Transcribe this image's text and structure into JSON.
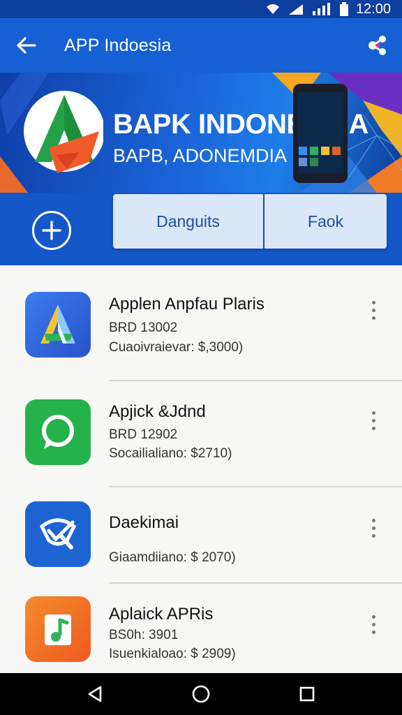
{
  "status_bar": {
    "time": "12:00",
    "icons": [
      "wifi-icon",
      "signal-icon",
      "signal-bars-icon",
      "battery-icon"
    ]
  },
  "app_bar": {
    "title": "APP Indoesia",
    "back_icon": "arrow-left-icon",
    "share_icon": "share-icon"
  },
  "banner": {
    "headline": "BAPK INDONEESIA",
    "subline": "BAPB, ADONEMDIA"
  },
  "actions": {
    "add_icon": "plus-circle-icon",
    "tabs": [
      {
        "label": "Danguits"
      },
      {
        "label": "Faok"
      }
    ]
  },
  "apps": [
    {
      "name": "Applen Anpfau Plaris",
      "code": "BRD 13002",
      "detail": "Cuaoivraievar: $,3000)",
      "icon": "a-logo-icon",
      "color": "#2f63d6"
    },
    {
      "name": "Apjick &Jdnd",
      "code": "BRD 12902",
      "detail": "Socailialiano: $2710)",
      "icon": "chat-bubble-icon",
      "color": "#25b24a"
    },
    {
      "name": "Daekimai",
      "code": "",
      "detail": "Giaamdiiano: $ 2070)",
      "icon": "shield-check-icon",
      "color": "#1d63d2"
    },
    {
      "name": "Aplaick APRis",
      "code": "BS0h: 3901",
      "detail": "Isuenkialoao: $ 2909)",
      "icon": "music-note-icon",
      "color": "#f07a25"
    }
  ],
  "nav": {
    "icons": [
      "back-triangle-icon",
      "home-circle-icon",
      "recents-square-icon"
    ]
  }
}
